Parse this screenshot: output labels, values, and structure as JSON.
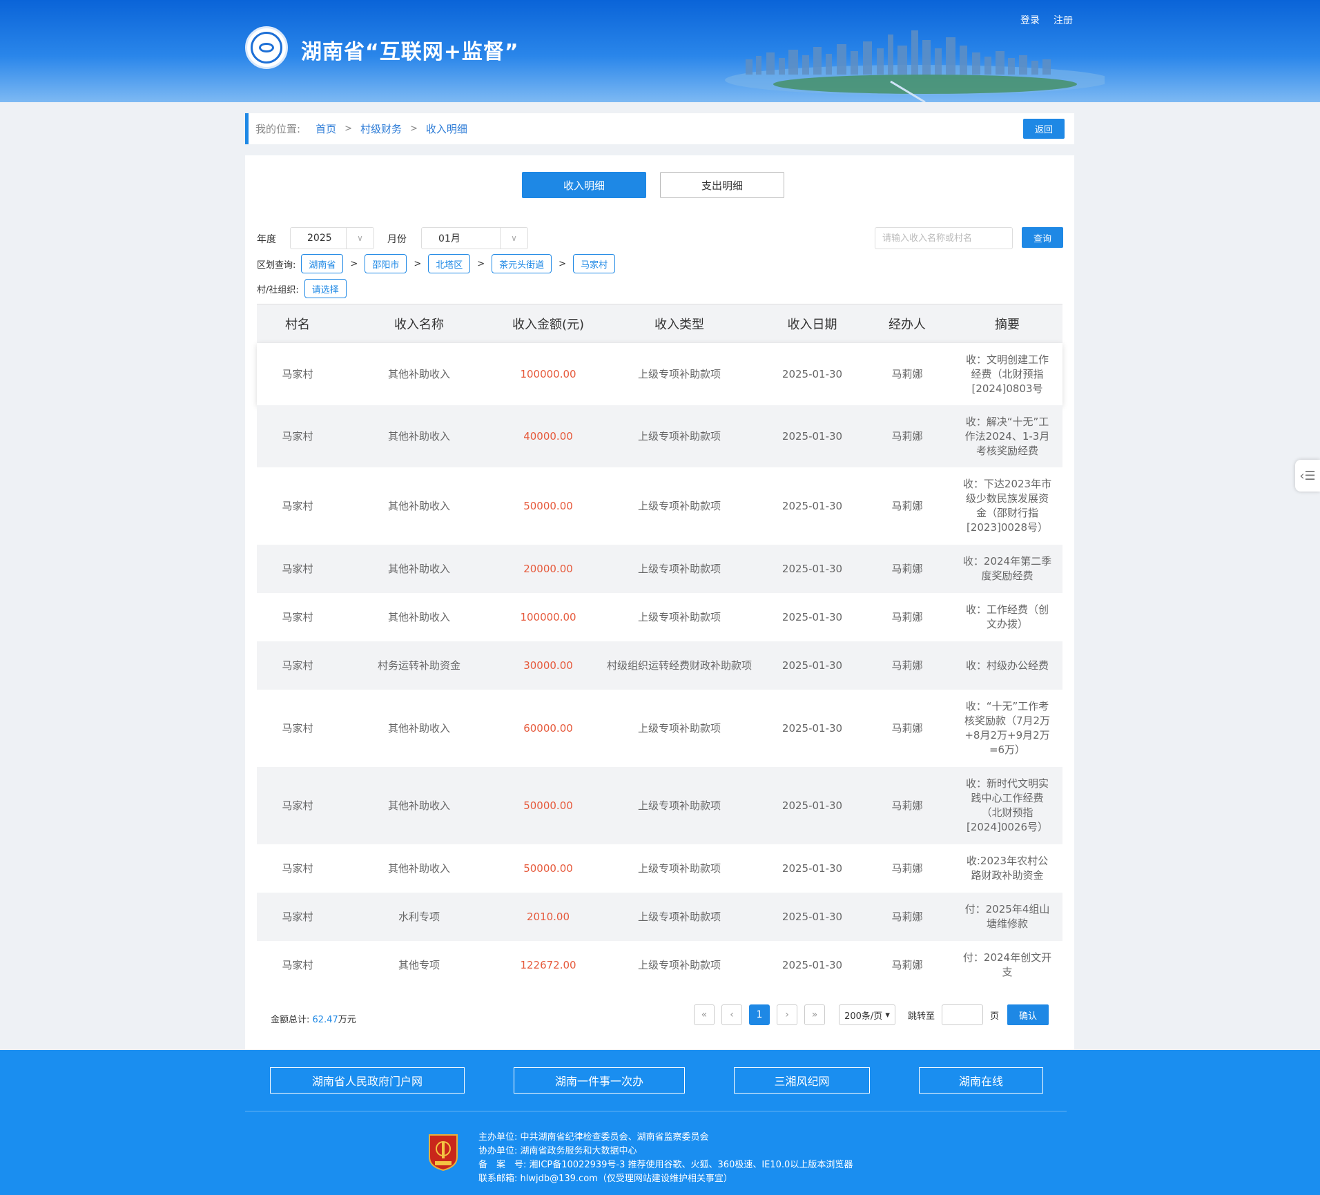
{
  "header": {
    "site_title": "湖南省“互联网+监督”",
    "login": "登录",
    "register": "注册"
  },
  "breadcrumb": {
    "label": "我的位置:",
    "items": [
      "首页",
      "村级财务",
      "收入明细"
    ],
    "separator": ">",
    "back": "返回"
  },
  "tabs": {
    "income": "收入明细",
    "expense": "支出明细"
  },
  "filters": {
    "year_label": "年度",
    "year_value": "2025",
    "month_label": "月份",
    "month_value": "01月",
    "search_placeholder": "请输入收入名称或村名",
    "query": "查询",
    "region_label": "区划查询:",
    "regions": [
      "湖南省",
      "邵阳市",
      "北塔区",
      "茶元头街道",
      "马家村"
    ],
    "org_label": "村/社组织:",
    "org_value": "请选择"
  },
  "table": {
    "columns": [
      "村名",
      "收入名称",
      "收入金额(元)",
      "收入类型",
      "收入日期",
      "经办人",
      "摘要"
    ],
    "rows": [
      [
        "马家村",
        "其他补助收入",
        "100000.00",
        "上级专项补助款项",
        "2025-01-30",
        "马莉娜",
        "收：文明创建工作经费（北财预指[2024]0803号"
      ],
      [
        "马家村",
        "其他补助收入",
        "40000.00",
        "上级专项补助款项",
        "2025-01-30",
        "马莉娜",
        "收：解决“十无”工作法2024、1-3月考核奖励经费"
      ],
      [
        "马家村",
        "其他补助收入",
        "50000.00",
        "上级专项补助款项",
        "2025-01-30",
        "马莉娜",
        "收：下达2023年市级少数民族发展资金（邵财行指[2023]0028号）"
      ],
      [
        "马家村",
        "其他补助收入",
        "20000.00",
        "上级专项补助款项",
        "2025-01-30",
        "马莉娜",
        "收：2024年第二季度奖励经费"
      ],
      [
        "马家村",
        "其他补助收入",
        "100000.00",
        "上级专项补助款项",
        "2025-01-30",
        "马莉娜",
        "收：工作经费（创文办拨）"
      ],
      [
        "马家村",
        "村务运转补助资金",
        "30000.00",
        "村级组织运转经费财政补助款项",
        "2025-01-30",
        "马莉娜",
        "收：村级办公经费"
      ],
      [
        "马家村",
        "其他补助收入",
        "60000.00",
        "上级专项补助款项",
        "2025-01-30",
        "马莉娜",
        "收：“十无”工作考核奖励款（7月2万+8月2万+9月2万=6万）"
      ],
      [
        "马家村",
        "其他补助收入",
        "50000.00",
        "上级专项补助款项",
        "2025-01-30",
        "马莉娜",
        "收：新时代文明实践中心工作经费（北财预指[2024]0026号）"
      ],
      [
        "马家村",
        "其他补助收入",
        "50000.00",
        "上级专项补助款项",
        "2025-01-30",
        "马莉娜",
        "收:2023年农村公路财政补助资金"
      ],
      [
        "马家村",
        "水利专项",
        "2010.00",
        "上级专项补助款项",
        "2025-01-30",
        "马莉娜",
        "付：2025年4组山塘维修款"
      ],
      [
        "马家村",
        "其他专项",
        "122672.00",
        "上级专项补助款项",
        "2025-01-30",
        "马莉娜",
        "付：2024年创文开支"
      ]
    ]
  },
  "summary": {
    "label": "金额总计:",
    "value": "62.47",
    "unit": "万元"
  },
  "pagination": {
    "first": "«",
    "prev": "‹",
    "current": "1",
    "next": "›",
    "last": "»",
    "page_size": "200条/页",
    "jump_label": "跳转至",
    "page_unit": "页",
    "confirm": "确认"
  },
  "footer": {
    "links": [
      "湖南省人民政府门户网",
      "湖南一件事一次办",
      "三湘风纪网",
      "湖南在线"
    ],
    "info": [
      "主办单位:  中共湖南省纪律检查委员会、湖南省监察委员会",
      "协办单位:  湖南省政务服务和大数据中心",
      "备　案　号:  湘ICP备10022939号-3   推荐使用谷歌、火狐、360极速、IE10.0以上版本浏览器",
      "联系邮箱:  hlwjdb@139.com（仅受理网站建设维护相关事宜）"
    ]
  },
  "colors": {
    "primary": "#1e88e5",
    "amount": "#e65a3c",
    "footer": "#1a8ef0"
  }
}
